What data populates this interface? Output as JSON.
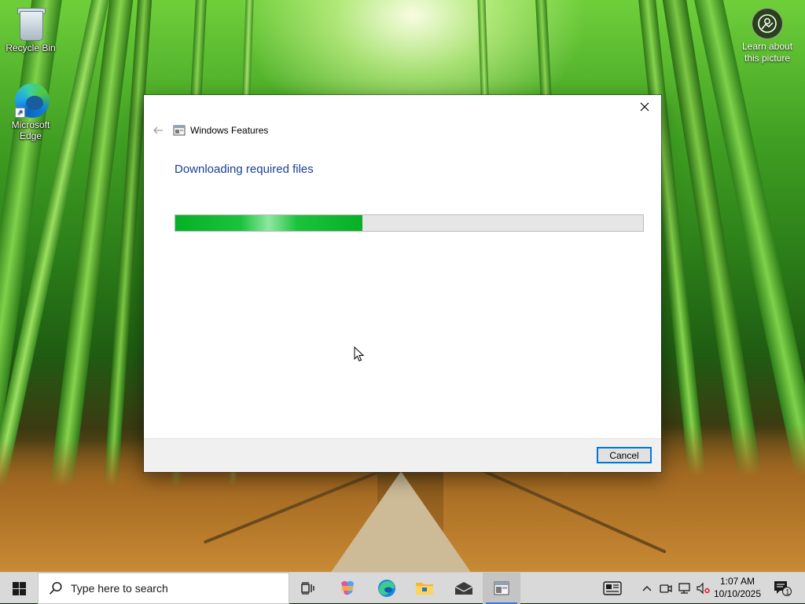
{
  "desktop": {
    "icons": [
      {
        "label": "Recycle Bin",
        "icon": "recycle-bin-icon"
      },
      {
        "label": "Microsoft\nEdge",
        "icon": "edge-icon"
      }
    ],
    "learn_picture": {
      "label": "Learn about\nthis picture",
      "icon": "learn-about-picture-icon"
    }
  },
  "dialog": {
    "nav_title": "Windows Features",
    "heading": "Downloading required files",
    "progress_fraction": 0.4,
    "cancel_label": "Cancel",
    "accent": "#06b025",
    "button_focus_color": "#0078d7"
  },
  "taskbar": {
    "search_placeholder": "Type here to search",
    "apps": [
      "task-view-icon",
      "copilot-icon",
      "edge-icon",
      "file-explorer-icon",
      "mail-icon",
      "windows-features-icon"
    ],
    "clock": {
      "time": "1:07 AM",
      "date": "10/10/2025"
    },
    "notification_count": "1"
  }
}
